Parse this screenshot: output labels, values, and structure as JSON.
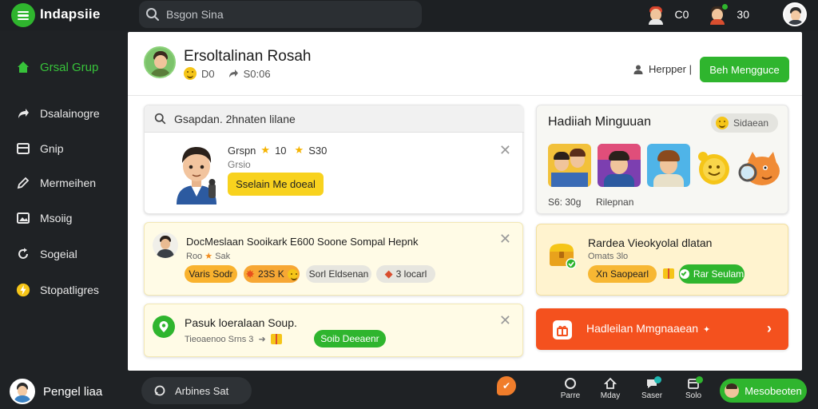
{
  "app": {
    "name": "Indapsiie",
    "search_placeholder": "Bsgon Sina"
  },
  "topbar": {
    "notif_count_1": "C0",
    "notif_count_2": "30"
  },
  "sidebar": {
    "items": [
      {
        "label": "Grsal Grup",
        "icon": "home-icon"
      },
      {
        "label": "Dsalainogre",
        "icon": "share-icon"
      },
      {
        "label": "Gnip",
        "icon": "box-icon"
      },
      {
        "label": "Mermeihen",
        "icon": "pencil-icon"
      },
      {
        "label": "Msoiig",
        "icon": "image-icon"
      },
      {
        "label": "Sogeial",
        "icon": "refresh-icon"
      },
      {
        "label": "Stopatligres",
        "icon": "lightning-icon"
      }
    ],
    "footer_name": "Pengel liaa"
  },
  "header": {
    "title": "Ersoltalinan Rosah",
    "meta_1": "D0",
    "meta_2": "S0:06",
    "helper": "Herpper |",
    "button": "Beh Mengguce"
  },
  "card_search": {
    "placeholder": "Gsapdan. 2hnaten lilane",
    "name": "Grspn",
    "rating_1": "10",
    "rating_2": "S30",
    "sub": "Grsio",
    "button": "Sselain Me doeal"
  },
  "card_notice": {
    "title": "DocMeslaan Sooikark E600 Soone Sompal Hepnk",
    "sub": "Roo",
    "sub_2": "Sak",
    "pill_1": "Varis Sodr",
    "pill_2": "23S K",
    "pill_3": "Sorl Eldsenan",
    "pill_4": "3 locarl"
  },
  "card_group": {
    "title": "Pasuk loeralaan Soup.",
    "sub": "Tieoaenoo Srns 3",
    "button": "Soib Deeaenr"
  },
  "reward": {
    "title": "Hadiiah Minguuan",
    "badge": "Sidaean",
    "foot_1": "S6: 30g",
    "foot_2": "Rilepnan"
  },
  "task": {
    "title": "Rardea Vieokyolal dlatan",
    "sub": "Omats 3lo",
    "pill": "Xn Saopearl",
    "button": "Rar Seulam"
  },
  "cta": {
    "label": "Hadleilan Mmgnaaean"
  },
  "bottombar": {
    "pill": "Arbines Sat",
    "items": [
      "Parre",
      "Mday",
      "Saser",
      "Solo"
    ],
    "button": "Mesobeoten"
  },
  "colors": {
    "brand_green": "#2fb52e",
    "accent_orange": "#f4511e",
    "accent_yellow": "#f8d21e",
    "sidebar_bg": "#1f2225"
  }
}
